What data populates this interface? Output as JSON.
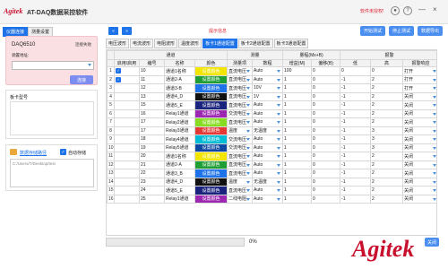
{
  "app": {
    "logo": "Agitek",
    "title": "AT-DAQ数据采控软件",
    "warning": "软件未授权!",
    "help_icon": "?",
    "minimize_icon": "—",
    "close_icon": "×"
  },
  "left_tabs": [
    "仪器连接",
    "测量设置"
  ],
  "device": {
    "name": "DAQ6510",
    "status": "连接失败",
    "ip_label": "调置地址:",
    "ip_value": "",
    "connect_label": "连接"
  },
  "info": {
    "title": "板卡型号"
  },
  "save": {
    "label": "数据存储路径",
    "auto_label": "自动存储",
    "path": "C:/Users/T/Desktop/test"
  },
  "nav": {
    "prev": "«",
    "next": "»"
  },
  "hint": "提示信息",
  "buttons": {
    "start": "开始测试",
    "stop": "停止测试",
    "export": "数据导出"
  },
  "subtabs": [
    "电压波形",
    "电流波形",
    "电阻波形",
    "温度波形",
    "板卡1通道配置",
    "板卡2通道配置",
    "板卡3通道配置"
  ],
  "table": {
    "groups": [
      "通道",
      "测量",
      "量程(Mx+B)",
      "报警"
    ],
    "headers": [
      "启用/启用",
      "编号",
      "名称",
      "颜色",
      "测量项",
      "数程",
      "增益(M)",
      "偏移(B)",
      "低",
      "高",
      "报警响应"
    ],
    "rows": [
      {
        "n": "1",
        "chk": true,
        "id": "10",
        "name": "通道1名称",
        "color": "设置颜色",
        "ccolor": "#f2e600",
        "meas": "直流电压",
        "range": "Auto",
        "gain": "100",
        "off": "0",
        "low": "0",
        "high": "0",
        "resp": "打开"
      },
      {
        "n": "2",
        "chk": true,
        "id": "11",
        "name": "通道2-A",
        "color": "设置颜色",
        "ccolor": "#1e9e34",
        "meas": "直流电压",
        "range": "Auto",
        "gain": "1",
        "off": "0",
        "low": "-1",
        "high": "2",
        "resp": "打开"
      },
      {
        "n": "3",
        "chk": false,
        "id": "12",
        "name": "通道3-B",
        "color": "设置颜色",
        "ccolor": "#1e73e8",
        "meas": "直流电压",
        "range": "10V",
        "gain": "1",
        "off": "0",
        "low": "-1",
        "high": "2",
        "resp": "打开"
      },
      {
        "n": "4",
        "chk": false,
        "id": "13",
        "name": "通道4_D",
        "color": "设置颜色",
        "ccolor": "#111111",
        "meas": "直流电压",
        "range": "1V",
        "gain": "1",
        "off": "0",
        "low": "-1",
        "high": "2",
        "resp": "关闭"
      },
      {
        "n": "5",
        "chk": false,
        "id": "15",
        "name": "通道5_E",
        "color": "设置颜色",
        "ccolor": "#1a237e",
        "meas": "直流电压",
        "range": "Auto",
        "gain": "1",
        "off": "0",
        "low": "-1",
        "high": "2",
        "resp": "关闭"
      },
      {
        "n": "6",
        "chk": false,
        "id": "16",
        "name": "Relay1通道",
        "color": "设置颜色",
        "ccolor": "#9c27b0",
        "meas": "交流电压",
        "range": "Auto",
        "gain": "1",
        "off": "0",
        "low": "-1",
        "high": "2",
        "resp": "关闭"
      },
      {
        "n": "7",
        "chk": false,
        "id": "17",
        "name": "Relay2通道",
        "color": "设置颜色",
        "ccolor": "#88dd22",
        "meas": "直流电压",
        "range": "Auto",
        "gain": "1",
        "off": "0",
        "low": "-1",
        "high": "2",
        "resp": "关闭"
      },
      {
        "n": "8",
        "chk": false,
        "id": "17",
        "name": "Relay3通道",
        "color": "设置颜色",
        "ccolor": "#e53935",
        "meas": "温度",
        "range": "无温度",
        "gain": "1",
        "off": "0",
        "low": "-1",
        "high": "3",
        "resp": "关闭"
      },
      {
        "n": "9",
        "chk": false,
        "id": "18",
        "name": "Relay4通道",
        "color": "设置颜色",
        "ccolor": "#00bcd4",
        "meas": "交流电压",
        "range": "Auto",
        "gain": "1",
        "off": "0",
        "low": "-1",
        "high": "3",
        "resp": "关闭"
      },
      {
        "n": "10",
        "chk": false,
        "id": "19",
        "name": "Relay5通道",
        "color": "设置颜色",
        "ccolor": "#0d47a1",
        "meas": "交流电压",
        "range": "Auto",
        "gain": "1",
        "off": "0",
        "low": "-1",
        "high": "3",
        "resp": "关闭"
      },
      {
        "n": "11",
        "chk": false,
        "id": "20",
        "name": "通道1名称",
        "color": "设置颜色",
        "ccolor": "#f2e600",
        "meas": "直流电压",
        "range": "Auto",
        "gain": "1",
        "off": "0",
        "low": "-1",
        "high": "2",
        "resp": "关闭"
      },
      {
        "n": "12",
        "chk": false,
        "id": "21",
        "name": "通道2-A",
        "color": "设置颜色",
        "ccolor": "#1e9e34",
        "meas": "直流电压",
        "range": "Auto",
        "gain": "1",
        "off": "0",
        "low": "-1",
        "high": "2",
        "resp": "关闭"
      },
      {
        "n": "13",
        "chk": false,
        "id": "22",
        "name": "通道3_B",
        "color": "设置颜色",
        "ccolor": "#1e73e8",
        "meas": "直流电压",
        "range": "Auto",
        "gain": "1",
        "off": "0",
        "low": "-1",
        "high": "2",
        "resp": "关闭"
      },
      {
        "n": "14",
        "chk": false,
        "id": "23",
        "name": "通道4_D",
        "color": "设置颜色",
        "ccolor": "#111111",
        "meas": "温度",
        "range": "无温度",
        "gain": "1",
        "off": "0",
        "low": "-1",
        "high": "2",
        "resp": "关闭"
      },
      {
        "n": "15",
        "chk": false,
        "id": "24",
        "name": "通道5_E",
        "color": "设置颜色",
        "ccolor": "#1a237e",
        "meas": "直流电压",
        "range": "Auto",
        "gain": "1",
        "off": "0",
        "low": "-1",
        "high": "2",
        "resp": "关闭"
      },
      {
        "n": "16",
        "chk": false,
        "id": "25",
        "name": "Relay1通道",
        "color": "设置颜色",
        "ccolor": "#9c27b0",
        "meas": "二线电阻",
        "range": "Auto",
        "gain": "1",
        "off": "0",
        "low": "-1",
        "high": "2",
        "resp": "关闭"
      }
    ]
  },
  "progress": {
    "value": 0,
    "label": "0%"
  },
  "close_label": "关闭",
  "watermark": "Agitek"
}
